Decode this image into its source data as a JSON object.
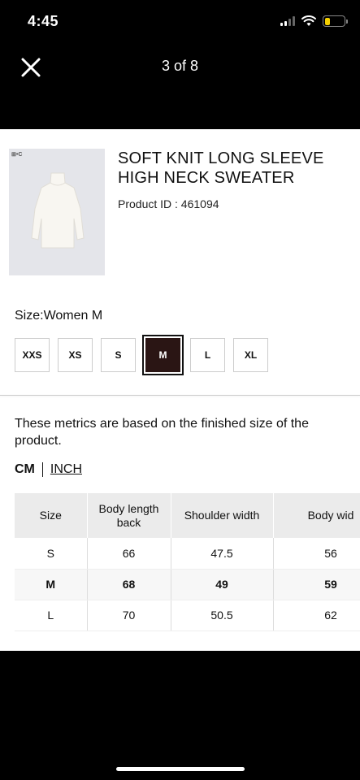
{
  "status_bar": {
    "time": "4:45"
  },
  "nav": {
    "page_counter": "3 of 8"
  },
  "product": {
    "brand_mark": "⊞•C",
    "title": "SOFT KNIT LONG SLEEVE HIGH NECK SWEATER",
    "product_id": "Product ID : 461094"
  },
  "size_selector": {
    "label": "Size:Women M",
    "options": [
      "XXS",
      "XS",
      "S",
      "M",
      "L",
      "XL"
    ],
    "selected": "M"
  },
  "metrics_note": "These metrics are based on the finished size of the product.",
  "units": {
    "cm": "CM",
    "inch": "INCH",
    "active": "CM"
  },
  "size_table": {
    "headers": [
      "Size",
      "Body length back",
      "Shoulder width",
      "Body wid"
    ],
    "rows": [
      [
        "S",
        "66",
        "47.5",
        "56"
      ],
      [
        "M",
        "68",
        "49",
        "59"
      ],
      [
        "L",
        "70",
        "50.5",
        "62"
      ]
    ],
    "highlighted_row": "M"
  },
  "colors": {
    "selected_size": "#2a1514",
    "header_bg": "#ebebeb"
  }
}
